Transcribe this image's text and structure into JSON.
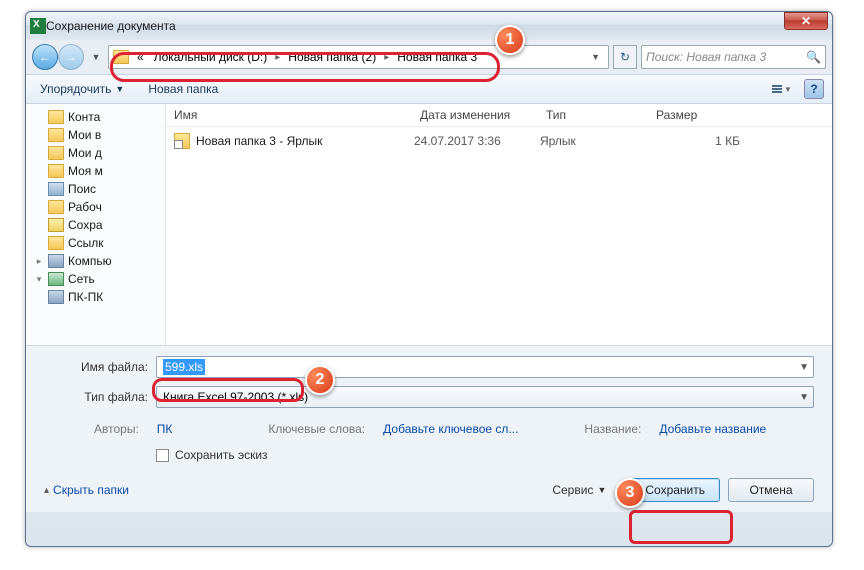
{
  "window": {
    "title": "Сохранение документа"
  },
  "nav": {
    "back_label": "←",
    "fwd_label": "→",
    "breadcrumb": {
      "prefix": "«",
      "parts": [
        "Локальный диск (D:)",
        "Новая папка (2)",
        "Новая папка 3"
      ]
    },
    "refresh": "↻",
    "search_placeholder": "Поиск: Новая папка 3"
  },
  "toolbar": {
    "organize": "Упорядочить",
    "new_folder": "Новая папка"
  },
  "tree": {
    "items": [
      {
        "label": "Конта",
        "depth": 2,
        "icon": "folder"
      },
      {
        "label": "Мои в",
        "depth": 2,
        "icon": "folder"
      },
      {
        "label": "Мои д",
        "depth": 2,
        "icon": "folder"
      },
      {
        "label": "Моя м",
        "depth": 2,
        "icon": "folder"
      },
      {
        "label": "Поис",
        "depth": 2,
        "icon": "search"
      },
      {
        "label": "Рабоч",
        "depth": 2,
        "icon": "folder"
      },
      {
        "label": "Сохра",
        "depth": 2,
        "icon": "folder"
      },
      {
        "label": "Ссылк",
        "depth": 2,
        "icon": "folder"
      },
      {
        "label": "Компью",
        "depth": 1,
        "icon": "computer",
        "expand": "▸"
      },
      {
        "label": "Сеть",
        "depth": 1,
        "icon": "network",
        "expand": "▾"
      },
      {
        "label": "ПК-ПК",
        "depth": 2,
        "icon": "computer"
      }
    ]
  },
  "filelist": {
    "columns": {
      "name": "Имя",
      "date": "Дата изменения",
      "type": "Тип",
      "size": "Размер"
    },
    "rows": [
      {
        "name": "Новая папка 3 - Ярлык",
        "date": "24.07.2017 3:36",
        "type": "Ярлык",
        "size": "1 КБ",
        "icon": "shortcut"
      }
    ]
  },
  "form": {
    "filename_label": "Имя файла:",
    "filename_value": "599.xls",
    "filetype_label": "Тип файла:",
    "filetype_value": "Книга Excel 97-2003 (*.xls)",
    "meta": {
      "authors_label": "Авторы:",
      "authors_value": "ПК",
      "keywords_label": "Ключевые слова:",
      "keywords_value": "Добавьте ключевое сл...",
      "title_label": "Название:",
      "title_value": "Добавьте название"
    },
    "thumbnail": "Сохранить эскиз",
    "hide_folders": "Скрыть папки",
    "service": "Сервис",
    "save": "Сохранить",
    "cancel": "Отмена"
  },
  "markers": {
    "m1": "1",
    "m2": "2",
    "m3": "3"
  }
}
